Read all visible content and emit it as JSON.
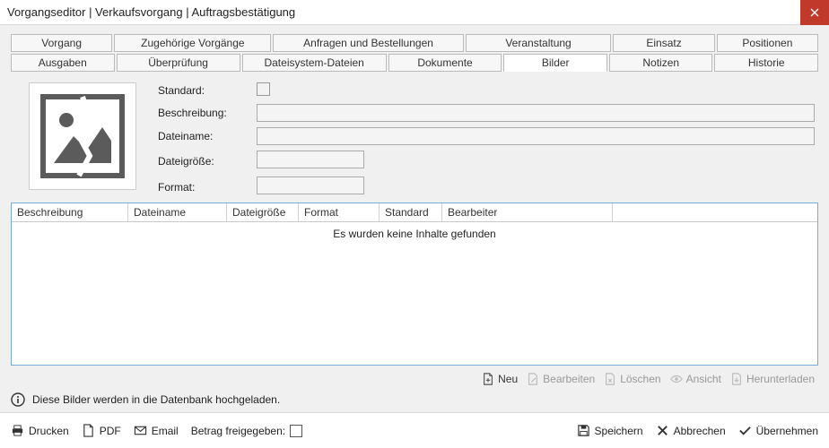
{
  "window": {
    "title": "Vorgangseditor | Verkaufsvorgang | Auftragsbestätigung"
  },
  "tabs_row1": [
    {
      "label": "Vorgang"
    },
    {
      "label": "Zugehörige Vorgänge"
    },
    {
      "label": "Anfragen und Bestellungen"
    },
    {
      "label": "Veranstaltung"
    },
    {
      "label": "Einsatz"
    },
    {
      "label": "Positionen"
    }
  ],
  "tabs_row2": [
    {
      "label": "Ausgaben"
    },
    {
      "label": "Überprüfung"
    },
    {
      "label": "Dateisystem-Dateien"
    },
    {
      "label": "Dokumente"
    },
    {
      "label": "Bilder",
      "active": true
    },
    {
      "label": "Notizen"
    },
    {
      "label": "Historie"
    }
  ],
  "form": {
    "standard_label": "Standard:",
    "beschreibung_label": "Beschreibung:",
    "dateiname_label": "Dateiname:",
    "dateigroesse_label": "Dateigröße:",
    "format_label": "Format:"
  },
  "table": {
    "cols": [
      "Beschreibung",
      "Dateiname",
      "Dateigröße",
      "Format",
      "Standard",
      "Bearbeiter"
    ],
    "empty_text": "Es wurden keine Inhalte gefunden"
  },
  "actions": {
    "neu": "Neu",
    "bearbeiten": "Bearbeiten",
    "loeschen": "Löschen",
    "ansicht": "Ansicht",
    "herunterladen": "Herunterladen"
  },
  "info_text": "Diese Bilder werden in die Datenbank hochgeladen.",
  "footer": {
    "drucken": "Drucken",
    "pdf": "PDF",
    "email": "Email",
    "betrag": "Betrag freigegeben:",
    "speichern": "Speichern",
    "abbrechen": "Abbrechen",
    "uebernehmen": "Übernehmen"
  }
}
